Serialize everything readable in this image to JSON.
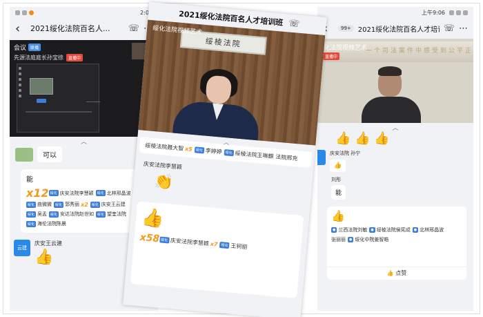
{
  "left": {
    "status_time": "2:09",
    "title": "2021绥化法院百名人...",
    "meeting_label": "会议",
    "meeting_badge": "联播",
    "presenter_text": "先源法庭庭长孙宝徐",
    "live_badge": "直播中",
    "chat_bubble": "可以",
    "card_title": "能",
    "card_count": "x12",
    "chips": [
      {
        "badge": "绥化",
        "name": "庆安法院李慧颖"
      },
      {
        "badge": "绥化",
        "name": "北林邢晶波"
      },
      {
        "badge": "绥化",
        "name": "曲微微"
      },
      {
        "badge": "绥化",
        "name": "郭秀丽",
        "mult": "x2"
      },
      {
        "badge": "绥化",
        "name": "庆安王云建"
      },
      {
        "badge": "绥化",
        "name": "吴孟"
      },
      {
        "badge": "绥化",
        "name": "安达法院赵世如"
      },
      {
        "badge": "绥化",
        "name": "望奎法院"
      },
      {
        "badge": "绥化",
        "name": "海伦法院陈晨"
      }
    ],
    "sender_avatar": "云建",
    "sender_name": "庆安王云建"
  },
  "middle": {
    "title": "2021绥化法院百名人才培训班",
    "overlay": "绥化法院视频艺术",
    "sign_text": "绥棱法院",
    "chips": [
      {
        "name": "绥棱法院聂大智",
        "mult": "x5"
      },
      {
        "badge": "绥化",
        "name": "李婷婷"
      },
      {
        "badge": "绥化",
        "name": "绥棱法院王琳麒"
      },
      {
        "name": "法院邢充"
      }
    ],
    "sender_name": "庆安法院李慧颖",
    "card_count": "x58",
    "chips2": [
      {
        "badge": "绥化",
        "name": "庆安法院李慧颖",
        "mult": "x7"
      },
      {
        "badge": "绥化",
        "name": "王钶丽"
      }
    ]
  },
  "right": {
    "status_time": "上午9:06",
    "unread": "99+",
    "title": "2021绥化法院百名人才培训班",
    "overlay": "绥化法院视频艺术",
    "live_badge": "直播中",
    "wall_text": "一个司法案件中感受到公平正义",
    "msg1_name": "庆安法院 孙宁",
    "msg2_name": "刘彤",
    "msg2_text": "能",
    "chips": [
      {
        "name": "兰西法院刘敏"
      },
      {
        "name": "绥棱法院侯宪成"
      },
      {
        "name": "北林邢晶波"
      },
      {
        "name": "张丽丽"
      },
      {
        "name": "绥化中院姜智皓"
      }
    ],
    "like_label": "点赞"
  }
}
